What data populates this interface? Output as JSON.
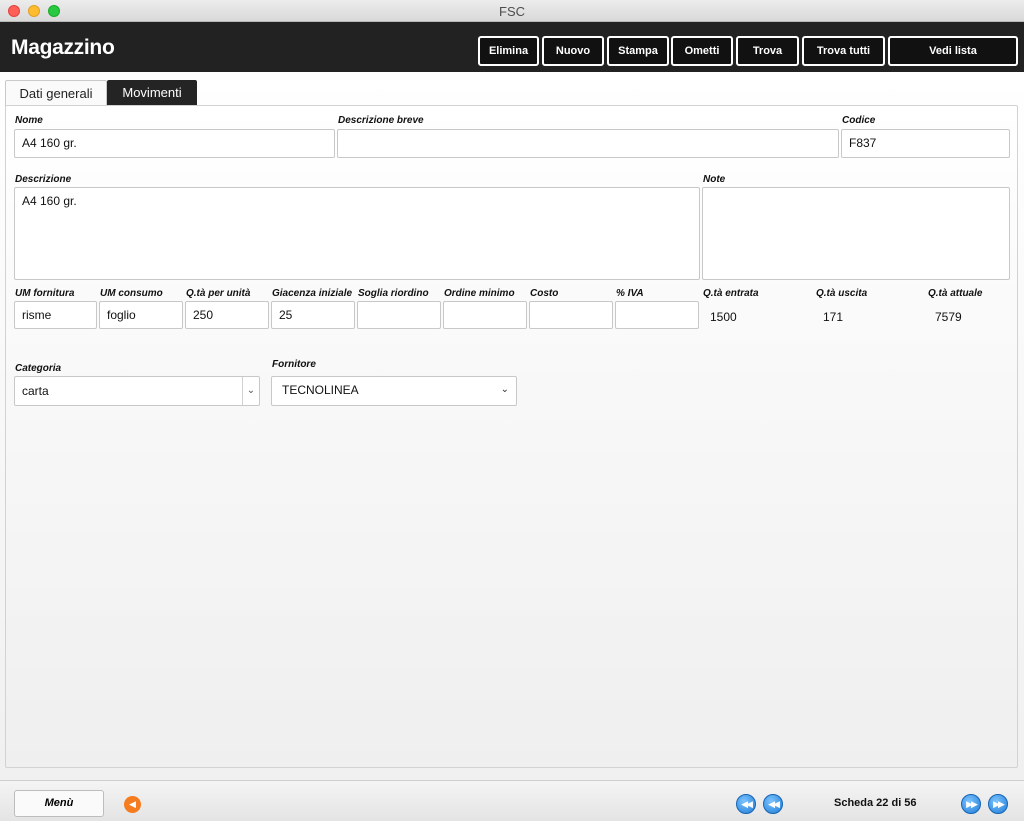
{
  "window": {
    "title": "FSC"
  },
  "header": {
    "title": "Magazzino",
    "buttons": [
      "Elimina",
      "Nuovo",
      "Stampa",
      "Ometti",
      "Trova",
      "Trova tutti",
      "Vedi lista"
    ]
  },
  "tabs": [
    "Dati generali",
    "Movimenti"
  ],
  "form": {
    "labels": {
      "nome": "Nome",
      "descrizione_breve": "Descrizione breve",
      "codice": "Codice",
      "descrizione": "Descrizione",
      "note": "Note",
      "um_fornitura": "UM fornitura",
      "um_consumo": "UM consumo",
      "qta_per_unita": "Q.tà per unità",
      "giacenza_iniziale": "Giacenza iniziale",
      "soglia_riordino": "Soglia riordino",
      "ordine_minimo": "Ordine minimo",
      "costo": "Costo",
      "iva": "% IVA",
      "qta_entrata": "Q.tà entrata",
      "qta_uscita": "Q.tà uscita",
      "qta_attuale": "Q.tà attuale",
      "categoria": "Categoria",
      "fornitore": "Fornitore"
    },
    "values": {
      "nome": "A4 160 gr.",
      "descrizione_breve": "",
      "codice": "F837",
      "descrizione": "A4 160 gr.",
      "note": "",
      "um_fornitura": "risme",
      "um_consumo": "foglio",
      "qta_per_unita": "250",
      "giacenza_iniziale": "25",
      "soglia_riordino": "",
      "ordine_minimo": "",
      "costo": "",
      "iva": "",
      "qta_entrata": "1500",
      "qta_uscita": "171",
      "qta_attuale": "7579",
      "categoria": "carta",
      "fornitore": "TECNOLINEA"
    }
  },
  "footer": {
    "menu_label": "Menù",
    "record_info": "Scheda 22 di 56",
    "icons": [
      "back-arrow-icon",
      "first-record-icon",
      "previous-record-icon",
      "next-record-icon",
      "last-record-icon"
    ]
  },
  "colors": {
    "header_bg": "#222222",
    "back_button": "#f57c1f",
    "nav_button": "#1f7bd6"
  }
}
